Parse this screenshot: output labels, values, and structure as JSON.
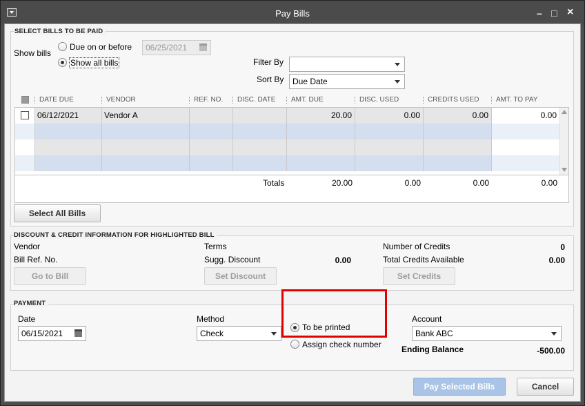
{
  "window": {
    "title": "Pay Bills",
    "controls": [
      "–",
      "□",
      "×"
    ]
  },
  "select_bills": {
    "section_title": "SELECT BILLS TO BE PAID",
    "show_bills_label": "Show bills",
    "due_on_or_before_label": "Due on or before",
    "due_date_value": "06/25/2021",
    "show_all_label": "Show all bills",
    "selected_option": "show_all",
    "filter_by_label": "Filter By",
    "filter_by_value": "",
    "sort_by_label": "Sort By",
    "sort_by_value": "Due Date"
  },
  "table": {
    "columns": [
      "DATE DUE",
      "VENDOR",
      "REF. NO.",
      "DISC. DATE",
      "AMT. DUE",
      "DISC. USED",
      "CREDITS USED",
      "AMT. TO PAY"
    ],
    "rows": [
      {
        "checked": false,
        "date_due": "06/12/2021",
        "vendor": "Vendor A",
        "ref_no": "",
        "disc_date": "",
        "amt_due": "20.00",
        "disc_used": "0.00",
        "credits_used": "0.00",
        "amt_to_pay": "0.00"
      }
    ],
    "totals": {
      "label": "Totals",
      "amt_due": "20.00",
      "disc_used": "0.00",
      "credits_used": "0.00",
      "amt_to_pay": "0.00"
    },
    "select_all_label": "Select All Bills"
  },
  "discount": {
    "section_title": "DISCOUNT & CREDIT INFORMATION FOR HIGHLIGHTED BILL",
    "vendor_label": "Vendor",
    "vendor_value": "",
    "bill_ref_label": "Bill Ref. No.",
    "terms_label": "Terms",
    "sugg_discount_label": "Sugg. Discount",
    "sugg_discount_value": "0.00",
    "num_credits_label": "Number of Credits",
    "num_credits_value": "0",
    "total_credits_label": "Total Credits Available",
    "total_credits_value": "0.00",
    "go_to_bill": "Go to Bill",
    "set_discount": "Set Discount",
    "set_credits": "Set Credits"
  },
  "payment": {
    "section_title": "PAYMENT",
    "date_label": "Date",
    "date_value": "06/15/2021",
    "method_label": "Method",
    "method_value": "Check",
    "to_be_printed_label": "To be printed",
    "assign_check_label": "Assign check number",
    "selected_print_option": "to_be_printed",
    "account_label": "Account",
    "account_value": "Bank ABC",
    "ending_balance_label": "Ending Balance",
    "ending_balance_value": "-500.00"
  },
  "footer": {
    "pay_selected": "Pay Selected Bills",
    "cancel": "Cancel"
  },
  "colors": {
    "highlight_box": "#e00000",
    "row_stripe": "#d3dfee",
    "row_alt": "#e6e6e6"
  }
}
